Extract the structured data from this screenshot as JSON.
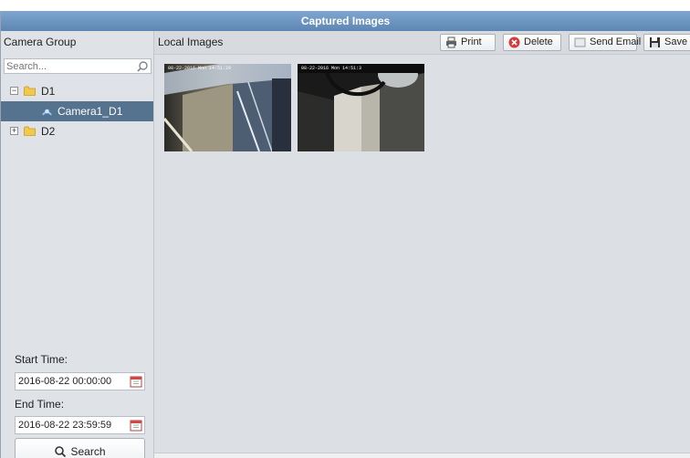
{
  "window": {
    "title": "Captured Images"
  },
  "left": {
    "header": "Camera Group",
    "search_placeholder": "Search...",
    "tree": [
      {
        "label": "D1",
        "expanded": true,
        "toggle": "−"
      },
      {
        "label": "Camera1_D1",
        "selected": true
      },
      {
        "label": "D2",
        "expanded": false,
        "toggle": "+"
      }
    ],
    "start_label": "Start Time:",
    "start_value": "2016-08-22 00:00:00",
    "end_label": "End Time:",
    "end_value": "2016-08-22 23:59:59",
    "search_button": "Search"
  },
  "right": {
    "header": "Local Images",
    "toolbar": {
      "print": "Print",
      "delete": "Delete",
      "send_email": "Send Email",
      "save_as": "Save as"
    },
    "thumbnails": [
      {
        "osd": "08-22-2016 Mon 14:51:29"
      },
      {
        "osd": "08-22-2016 Mon 14:51:3"
      }
    ]
  },
  "colors": {
    "titlebar": "#6b93be",
    "selected_row": "#55728f",
    "delete_icon": "#d23c3c",
    "folder": "#f2c94c"
  },
  "icons": [
    "search-icon",
    "folder-icon",
    "camera-icon",
    "calendar-icon",
    "print-icon",
    "delete-icon",
    "email-icon",
    "save-icon"
  ]
}
